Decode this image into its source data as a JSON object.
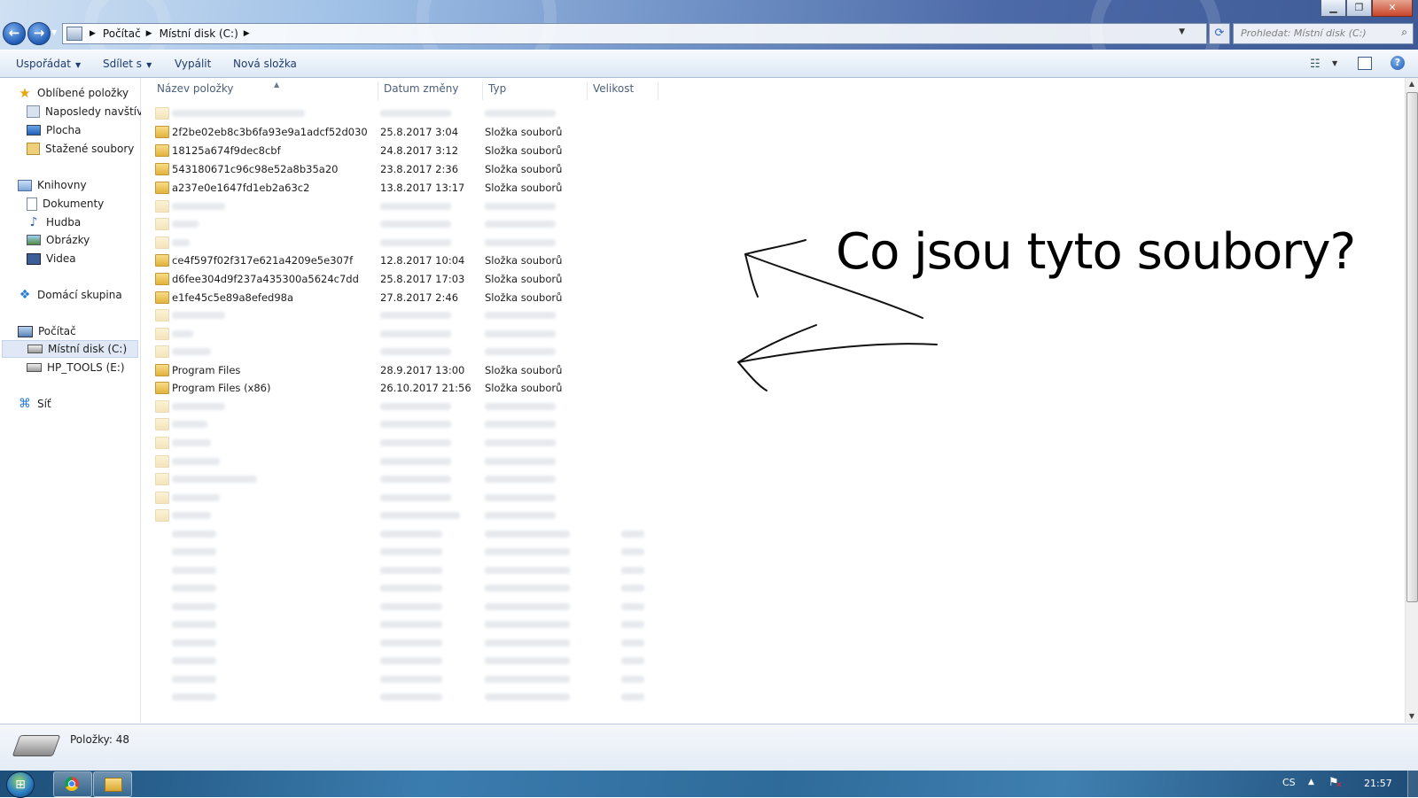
{
  "titlebar": {
    "controls": {
      "minimize": "▁",
      "maximize": "❐",
      "close": "✕"
    },
    "breadcrumb": [
      "Počítač",
      "Místní disk (C:)"
    ],
    "search_placeholder": "Prohledat: Místní disk (C:)"
  },
  "toolbar": {
    "organize": "Uspořádat",
    "share": "Sdílet s",
    "burn": "Vypálit",
    "new_folder": "Nová složka"
  },
  "nav": {
    "favorites": "Oblíbené položky",
    "recent": "Naposledy navštíver",
    "desktop": "Plocha",
    "downloads": "Stažené soubory",
    "libraries": "Knihovny",
    "documents": "Dokumenty",
    "music": "Hudba",
    "pictures": "Obrázky",
    "videos": "Videa",
    "homegroup": "Domácí skupina",
    "computer": "Počítač",
    "local_disk": "Místní disk (C:)",
    "hp_tools": "HP_TOOLS (E:)",
    "network": "Síť"
  },
  "columns": {
    "name": "Název položky",
    "date": "Datum změny",
    "type": "Typ",
    "size": "Velikost"
  },
  "files": [
    {
      "name": "2f2be02eb8c3b6fa93e9a1adcf52d030",
      "date": "25.8.2017 3:04",
      "type": "Složka souborů"
    },
    {
      "name": "18125a674f9dec8cbf",
      "date": "24.8.2017 3:12",
      "type": "Složka souborů"
    },
    {
      "name": "543180671c96c98e52a8b35a20",
      "date": "23.8.2017 2:36",
      "type": "Složka souborů"
    },
    {
      "name": "a237e0e1647fd1eb2a63c2",
      "date": "13.8.2017 13:17",
      "type": "Složka souborů"
    },
    {
      "name": "ce4f597f02f317e621a4209e5e307f",
      "date": "12.8.2017 10:04",
      "type": "Složka souborů"
    },
    {
      "name": "d6fee304d9f237a435300a5624c7dd",
      "date": "25.8.2017 17:03",
      "type": "Složka souborů"
    },
    {
      "name": "e1fe45c5e89a8efed98a",
      "date": "27.8.2017 2:46",
      "type": "Složka souborů"
    },
    {
      "name": "Program Files",
      "date": "28.9.2017 13:00",
      "type": "Složka souborů"
    },
    {
      "name": "Program Files (x86)",
      "date": "26.10.2017 21:56",
      "type": "Složka souborů"
    }
  ],
  "annotation": "Co jsou tyto soubory?",
  "status": {
    "items": "Položky: 48"
  },
  "taskbar": {
    "language": "CS",
    "clock": "21:57"
  }
}
